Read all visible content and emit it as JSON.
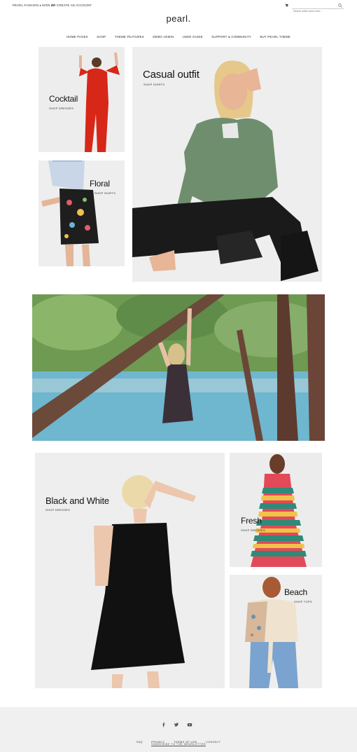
{
  "topbar": {
    "site_selector": "PEARL FASHION ▾",
    "sign_in": "SIGN IN",
    "or": "OR",
    "create_account": "CREATE AN ACCOUNT",
    "search_placeholder": "Search entire store here..."
  },
  "header": {
    "logo": "pearl."
  },
  "nav": {
    "items": [
      "HOME PAGES",
      "SHOP",
      "THEME FEATURES",
      "DEMO ADMIN",
      "USER GUIDE",
      "SUPPORT & COMMUNITY",
      "BUY PEARL THEME"
    ]
  },
  "tiles": {
    "cocktail": {
      "title": "Cocktail",
      "sub": "SHOP DRESSES"
    },
    "floral": {
      "title": "Floral",
      "sub": "SHOP SKIRTS"
    },
    "casual": {
      "title": "Casual outfit",
      "sub": "SHOP SHIRTS"
    },
    "bw": {
      "title": "Black and White",
      "sub": "SHOP DRESSES"
    },
    "fresh": {
      "title": "Fresh",
      "sub": "SHOP DRESSES"
    },
    "beach": {
      "title": "Beach",
      "sub": "SHOP TOPS"
    }
  },
  "footer": {
    "social": [
      "facebook-icon",
      "twitter-icon",
      "youtube-icon"
    ],
    "links": [
      "FAQ",
      "PRIVACY",
      "TERMS OF USE",
      "CONTACT"
    ],
    "newsletter": "SUBSCRIBE TO THE NEWSLETTER"
  },
  "colors": {
    "accent": "#222222",
    "footer_bg": "#f0f0f0"
  }
}
